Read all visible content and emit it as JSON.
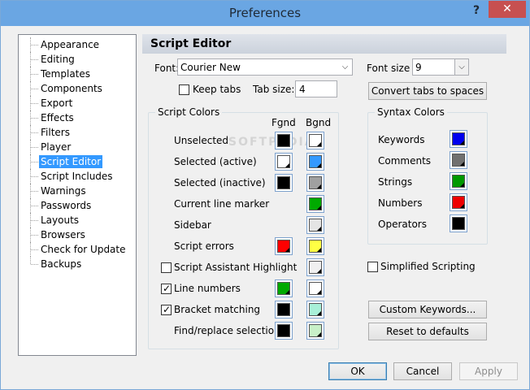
{
  "window": {
    "title": "Preferences",
    "help": "?",
    "close": "✕"
  },
  "tree": {
    "items": [
      {
        "label": "Appearance"
      },
      {
        "label": "Editing"
      },
      {
        "label": "Templates"
      },
      {
        "label": "Components"
      },
      {
        "label": "Export"
      },
      {
        "label": "Effects"
      },
      {
        "label": "Filters"
      },
      {
        "label": "Player"
      },
      {
        "label": "Script Editor",
        "selected": true
      },
      {
        "label": "Script Includes"
      },
      {
        "label": "Warnings"
      },
      {
        "label": "Passwords"
      },
      {
        "label": "Layouts"
      },
      {
        "label": "Browsers"
      },
      {
        "label": "Check for Update"
      },
      {
        "label": "Backups"
      }
    ]
  },
  "panel": {
    "title": "Script Editor"
  },
  "font": {
    "label": "Font:",
    "value": "Courier New"
  },
  "font_size": {
    "label": "Font size",
    "value": "9"
  },
  "keep_tabs": {
    "label": "Keep tabs",
    "checked": false
  },
  "tab_size": {
    "label": "Tab size:",
    "value": "4"
  },
  "convert_tabs_label": "Convert tabs to spaces",
  "script_colors": {
    "title": "Script Colors",
    "fgnd": "Fgnd",
    "bgnd": "Bgnd",
    "rows": [
      {
        "label": "Unselected",
        "fg": "#000000",
        "bg": "#ffffff"
      },
      {
        "label": "Selected (active)",
        "fg": "#ffffff",
        "bg": "#3399ff"
      },
      {
        "label": "Selected (inactive)",
        "fg": "#000000",
        "bg": "#a0a0a0"
      },
      {
        "label": "Current line marker",
        "fg": null,
        "bg": "#00aa00"
      },
      {
        "label": "Sidebar",
        "fg": null,
        "bg": "#e4e4e4"
      },
      {
        "label": "Script errors",
        "fg": "#ff0000",
        "bg": "#ffff44"
      },
      {
        "label": "Script Assistant Highlight",
        "fg": null,
        "bg": "#f0f0f0",
        "checkbox": true,
        "checked": false
      },
      {
        "label": "Line numbers",
        "fg": "#00aa00",
        "bg": "#ffffff",
        "checkbox": true,
        "checked": true
      },
      {
        "label": "Bracket matching",
        "fg": "#000000",
        "bg": "#a8f0d8",
        "checkbox": true,
        "checked": true
      },
      {
        "label": "Find/replace selection",
        "fg": "#000000",
        "bg": "#c8f0c8"
      }
    ]
  },
  "syntax_colors": {
    "title": "Syntax Colors",
    "rows": [
      {
        "label": "Keywords",
        "color": "#0000ee"
      },
      {
        "label": "Comments",
        "color": "#707070"
      },
      {
        "label": "Strings",
        "color": "#009900"
      },
      {
        "label": "Numbers",
        "color": "#ee0000"
      },
      {
        "label": "Operators",
        "color": "#000000"
      }
    ]
  },
  "simplified_scripting": {
    "label": "Simplified Scripting",
    "checked": false
  },
  "custom_keywords_label": "Custom Keywords...",
  "reset_defaults_label": "Reset to defaults",
  "footer": {
    "ok": "OK",
    "cancel": "Cancel",
    "apply": "Apply"
  },
  "watermark": "SOFTPEDIA"
}
